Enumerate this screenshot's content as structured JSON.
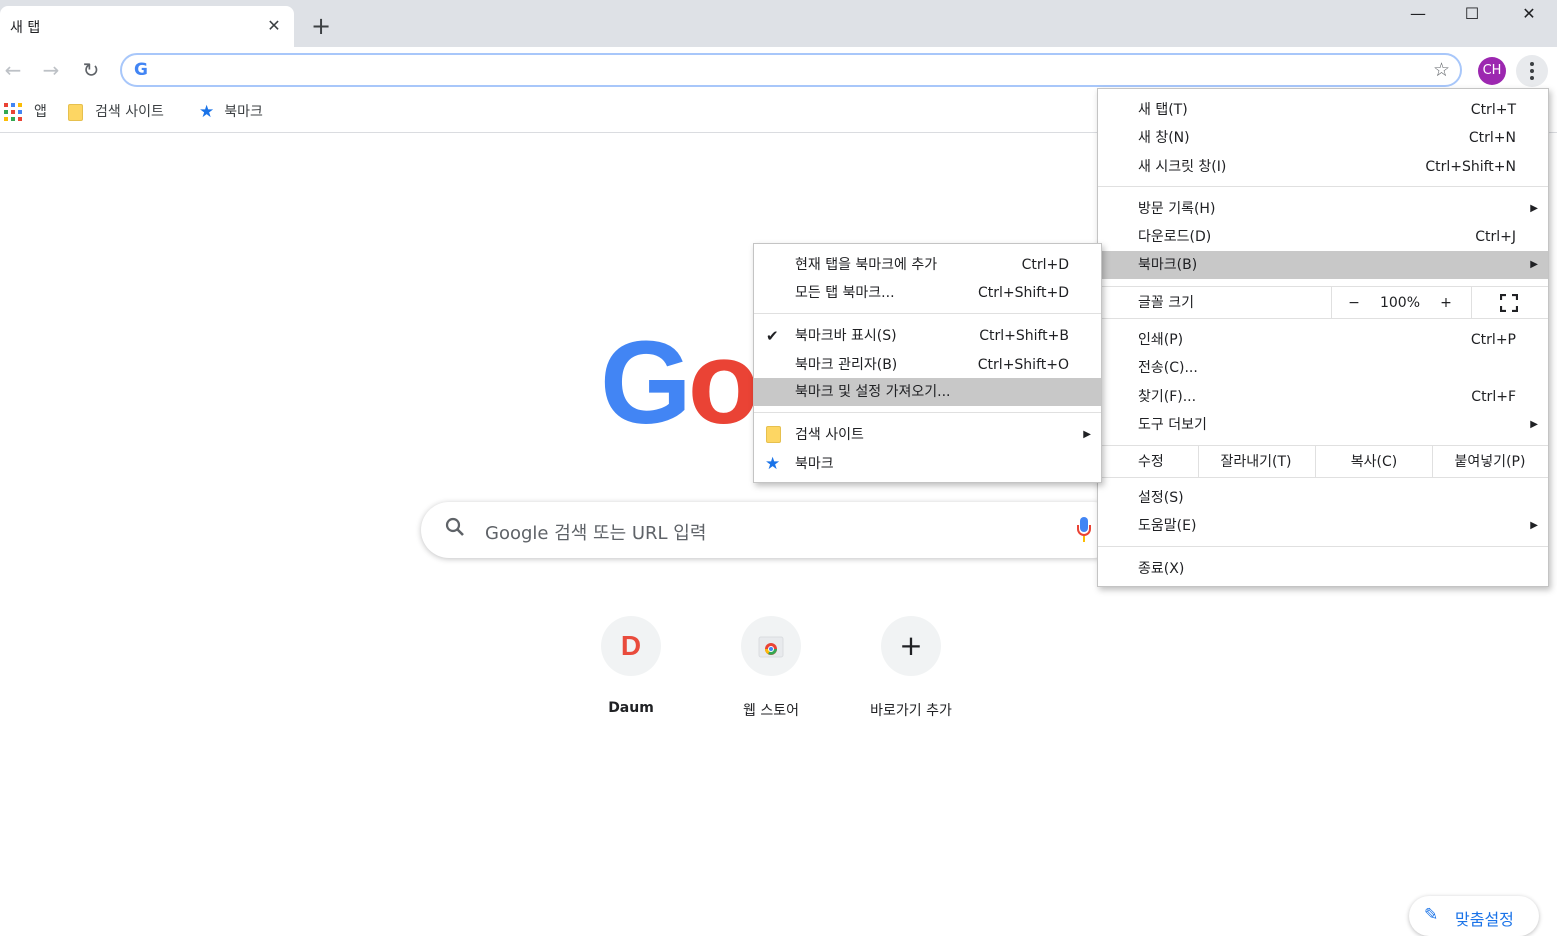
{
  "tab": {
    "title": "새 탭",
    "close": "✕",
    "new_tab": "+"
  },
  "window": {
    "minimize": "—",
    "maximize": "☐",
    "close": "✕"
  },
  "toolbar": {
    "back": "←",
    "forward": "→",
    "reload": "↻",
    "omnibox_g": "G",
    "star": "☆",
    "avatar": "CH"
  },
  "bookmarks_bar": {
    "apps": "앱",
    "folder": "검색 사이트",
    "bookmarks": "북마크"
  },
  "colors": {
    "accent": "#1a73e8",
    "avatar": "#9c27b0",
    "menu_highlight": "#c8c8c8"
  },
  "logo": {
    "g": "G",
    "o": "o"
  },
  "search": {
    "placeholder": "Google 검색 또는 URL 입력"
  },
  "shortcuts": [
    {
      "label": "Daum",
      "icon": "D"
    },
    {
      "label": "웹 스토어"
    },
    {
      "label": "바로가기 추가",
      "icon": "+"
    }
  ],
  "customize": {
    "label": "맞춤설정"
  },
  "main_menu": {
    "items": [
      {
        "label": "새 탭(T)",
        "shortcut": "Ctrl+T"
      },
      {
        "label": "새 창(N)",
        "shortcut": "Ctrl+N"
      },
      {
        "label": "새 시크릿 창(I)",
        "shortcut": "Ctrl+Shift+N"
      },
      {
        "label": "방문 기록(H)"
      },
      {
        "label": "다운로드(D)",
        "shortcut": "Ctrl+J"
      },
      {
        "label": "북마크(B)"
      },
      {
        "label": "인쇄(P)",
        "shortcut": "Ctrl+P"
      },
      {
        "label": "전송(C)..."
      },
      {
        "label": "찾기(F)...",
        "shortcut": "Ctrl+F"
      },
      {
        "label": "도구 더보기"
      },
      {
        "label": "설정(S)"
      },
      {
        "label": "도움말(E)"
      },
      {
        "label": "종료(X)"
      }
    ],
    "zoom": {
      "label": "글꼴 크기",
      "minus": "−",
      "value": "100%",
      "plus": "+"
    },
    "edit": {
      "label": "수정",
      "cut": "잘라내기(T)",
      "copy": "복사(C)",
      "paste": "붙여넣기(P)"
    }
  },
  "bookmark_menu": {
    "items": [
      {
        "label": "현재 탭을 북마크에 추가",
        "shortcut": "Ctrl+D"
      },
      {
        "label": "모든 탭 북마크...",
        "shortcut": "Ctrl+Shift+D"
      },
      {
        "label": "북마크바 표시(S)",
        "shortcut": "Ctrl+Shift+B",
        "check": "✔"
      },
      {
        "label": "북마크 관리자(B)",
        "shortcut": "Ctrl+Shift+O"
      },
      {
        "label": "북마크 및 설정 가져오기..."
      },
      {
        "label": "검색 사이트"
      },
      {
        "label": "북마크"
      }
    ]
  }
}
